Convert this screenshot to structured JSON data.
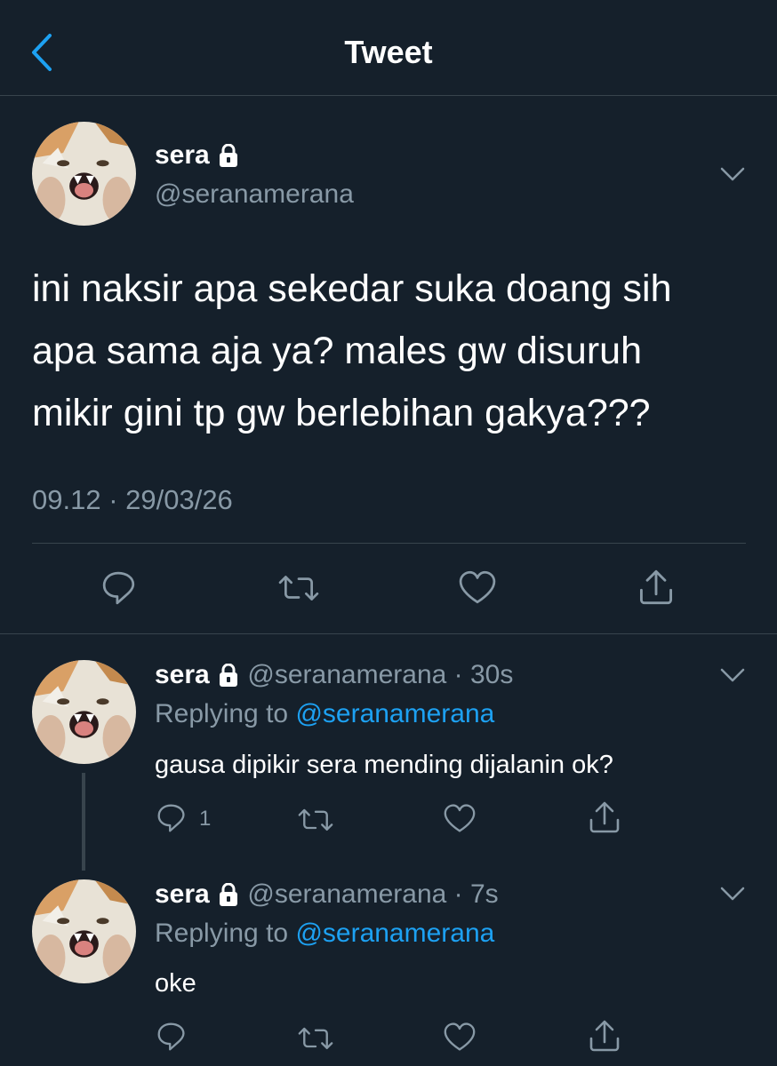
{
  "header": {
    "title": "Tweet",
    "back_icon": "chevron-left-icon",
    "accent": "#1da1f2"
  },
  "main_tweet": {
    "name": "sera",
    "handle": "@seranamerana",
    "lines": [
      "ini naksir apa sekedar suka doang sih",
      "apa sama aja ya? males gw disuruh",
      "mikir gini tp gw berlebihan gakya???"
    ],
    "timestamp": "09.12 · 29/03/26"
  },
  "replies": [
    {
      "name": "sera",
      "handle": "@seranamerana",
      "time": "· 30s",
      "replying_label": "Replying to",
      "replying_to": "@seranamerana",
      "text": "gausa dipikir sera mending dijalanin ok?",
      "reply_count": "1"
    },
    {
      "name": "sera",
      "handle": "@seranamerana",
      "time": "· 7s",
      "replying_label": "Replying to",
      "replying_to": "@seranamerana",
      "text": "oke",
      "reply_count": ""
    }
  ],
  "colors": {
    "background": "#15202b",
    "muted": "#8899a6",
    "divider": "#38444d"
  }
}
